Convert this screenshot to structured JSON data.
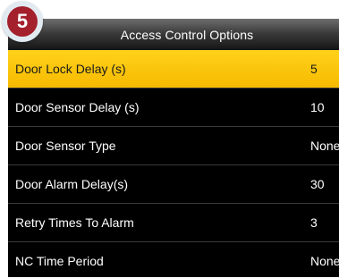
{
  "step_badge": {
    "number": "5"
  },
  "header": {
    "title": "Access Control Options"
  },
  "menu": {
    "items": [
      {
        "label": "Door Lock Delay (s)",
        "value": "5"
      },
      {
        "label": "Door Sensor Delay (s)",
        "value": "10"
      },
      {
        "label": "Door Sensor Type",
        "value": "None"
      },
      {
        "label": "Door Alarm Delay(s)",
        "value": "30"
      },
      {
        "label": "Retry Times To Alarm",
        "value": "3"
      },
      {
        "label": "NC Time Period",
        "value": "None"
      }
    ],
    "selected_index": 0
  },
  "colors": {
    "selected_row": "#f6ba00",
    "background": "#000000",
    "badge": "#a3202c"
  }
}
